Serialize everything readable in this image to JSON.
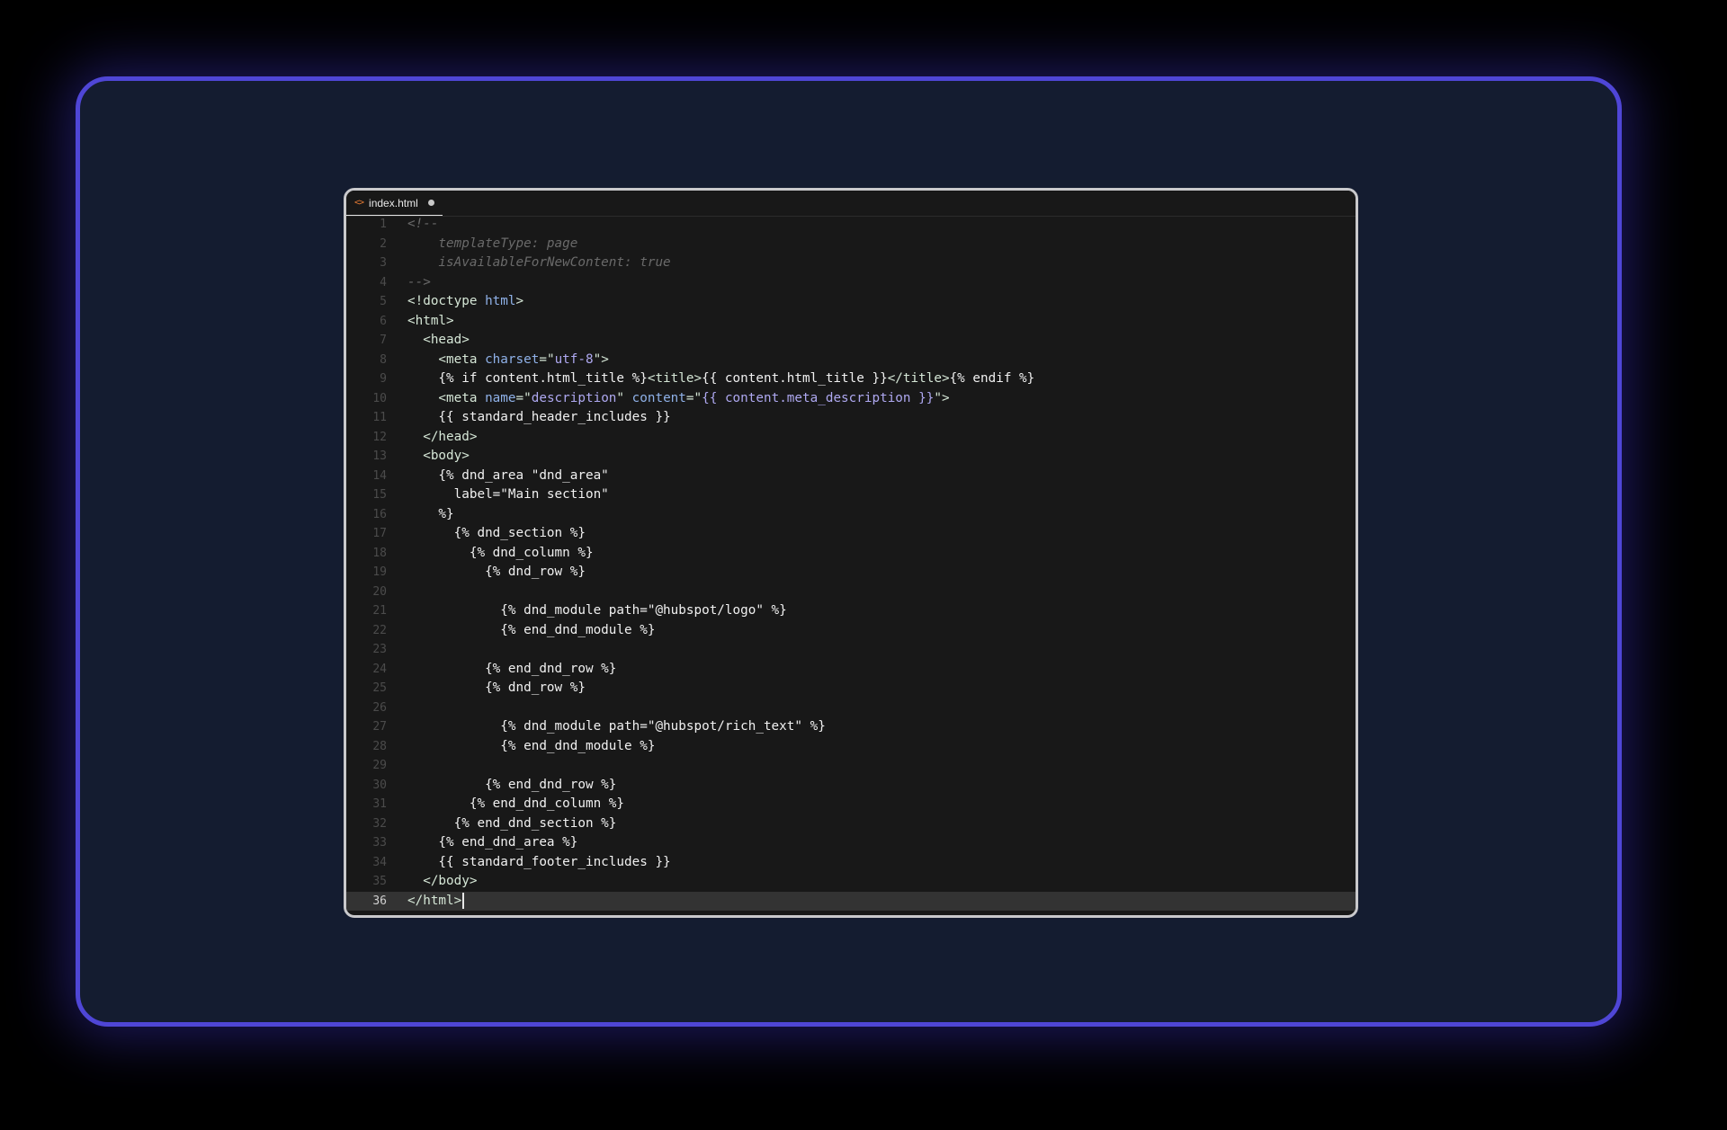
{
  "editor": {
    "tab": {
      "icon": "<>",
      "filename": "index.html",
      "unsaved_indicator": "●"
    },
    "active_line": 36,
    "lines": [
      {
        "n": "1",
        "parts": [
          {
            "t": "<!--",
            "c": "cmt"
          }
        ]
      },
      {
        "n": "2",
        "parts": [
          {
            "t": "    templateType: page",
            "c": "cmt"
          }
        ]
      },
      {
        "n": "3",
        "parts": [
          {
            "t": "    isAvailableForNewContent: true",
            "c": "cmt"
          }
        ]
      },
      {
        "n": "4",
        "parts": [
          {
            "t": "-->",
            "c": "cmt"
          }
        ]
      },
      {
        "n": "5",
        "parts": [
          {
            "t": "<!doctype ",
            "c": "tag"
          },
          {
            "t": "html",
            "c": "attr"
          },
          {
            "t": ">",
            "c": "tag"
          }
        ]
      },
      {
        "n": "6",
        "parts": [
          {
            "t": "<html>",
            "c": "tag"
          }
        ]
      },
      {
        "n": "7",
        "parts": [
          {
            "t": "  <head>",
            "c": "tag"
          }
        ]
      },
      {
        "n": "8",
        "parts": [
          {
            "t": "    <meta ",
            "c": "tag"
          },
          {
            "t": "charset",
            "c": "attr"
          },
          {
            "t": "=\"",
            "c": "tag"
          },
          {
            "t": "utf-8",
            "c": "str"
          },
          {
            "t": "\">",
            "c": "tag"
          }
        ]
      },
      {
        "n": "9",
        "parts": [
          {
            "t": "    {% if content.html_title %}",
            "c": "tpl"
          },
          {
            "t": "<title>",
            "c": "tag"
          },
          {
            "t": "{{ content.html_title }}",
            "c": "tpl"
          },
          {
            "t": "</title>",
            "c": "tag"
          },
          {
            "t": "{% endif %}",
            "c": "tpl"
          }
        ]
      },
      {
        "n": "10",
        "parts": [
          {
            "t": "    <meta ",
            "c": "tag"
          },
          {
            "t": "name",
            "c": "attr"
          },
          {
            "t": "=\"",
            "c": "tag"
          },
          {
            "t": "description",
            "c": "str"
          },
          {
            "t": "\" ",
            "c": "tag"
          },
          {
            "t": "content",
            "c": "attr"
          },
          {
            "t": "=\"",
            "c": "tag"
          },
          {
            "t": "{{ content.meta_description }}",
            "c": "str"
          },
          {
            "t": "\">",
            "c": "tag"
          }
        ]
      },
      {
        "n": "11",
        "parts": [
          {
            "t": "    {{ standard_header_includes }}",
            "c": "tpl"
          }
        ]
      },
      {
        "n": "12",
        "parts": [
          {
            "t": "  </head>",
            "c": "tag"
          }
        ]
      },
      {
        "n": "13",
        "parts": [
          {
            "t": "  <body>",
            "c": "tag"
          }
        ]
      },
      {
        "n": "14",
        "parts": [
          {
            "t": "    {% dnd_area \"dnd_area\"",
            "c": "tpl"
          }
        ]
      },
      {
        "n": "15",
        "parts": [
          {
            "t": "      label=\"Main section\"",
            "c": "tpl"
          }
        ]
      },
      {
        "n": "16",
        "parts": [
          {
            "t": "    %}",
            "c": "tpl"
          }
        ]
      },
      {
        "n": "17",
        "parts": [
          {
            "t": "      {% dnd_section %}",
            "c": "tpl"
          }
        ]
      },
      {
        "n": "18",
        "parts": [
          {
            "t": "        {% dnd_column %}",
            "c": "tpl"
          }
        ]
      },
      {
        "n": "19",
        "parts": [
          {
            "t": "          {% dnd_row %}",
            "c": "tpl"
          }
        ]
      },
      {
        "n": "20",
        "parts": [
          {
            "t": "",
            "c": "tpl"
          }
        ]
      },
      {
        "n": "21",
        "parts": [
          {
            "t": "            {% dnd_module path=\"@hubspot/logo\" %}",
            "c": "tpl"
          }
        ]
      },
      {
        "n": "22",
        "parts": [
          {
            "t": "            {% end_dnd_module %}",
            "c": "tpl"
          }
        ]
      },
      {
        "n": "23",
        "parts": [
          {
            "t": "",
            "c": "tpl"
          }
        ]
      },
      {
        "n": "24",
        "parts": [
          {
            "t": "          {% end_dnd_row %}",
            "c": "tpl"
          }
        ]
      },
      {
        "n": "25",
        "parts": [
          {
            "t": "          {% dnd_row %}",
            "c": "tpl"
          }
        ]
      },
      {
        "n": "26",
        "parts": [
          {
            "t": "",
            "c": "tpl"
          }
        ]
      },
      {
        "n": "27",
        "parts": [
          {
            "t": "            {% dnd_module path=\"@hubspot/rich_text\" %}",
            "c": "tpl"
          }
        ]
      },
      {
        "n": "28",
        "parts": [
          {
            "t": "            {% end_dnd_module %}",
            "c": "tpl"
          }
        ]
      },
      {
        "n": "29",
        "parts": [
          {
            "t": "",
            "c": "tpl"
          }
        ]
      },
      {
        "n": "30",
        "parts": [
          {
            "t": "          {% end_dnd_row %}",
            "c": "tpl"
          }
        ]
      },
      {
        "n": "31",
        "parts": [
          {
            "t": "        {% end_dnd_column %}",
            "c": "tpl"
          }
        ]
      },
      {
        "n": "32",
        "parts": [
          {
            "t": "      {% end_dnd_section %}",
            "c": "tpl"
          }
        ]
      },
      {
        "n": "33",
        "parts": [
          {
            "t": "    {% end_dnd_area %}",
            "c": "tpl"
          }
        ]
      },
      {
        "n": "34",
        "parts": [
          {
            "t": "    {{ standard_footer_includes }}",
            "c": "tpl"
          }
        ]
      },
      {
        "n": "35",
        "parts": [
          {
            "t": "  </body>",
            "c": "tag"
          }
        ]
      },
      {
        "n": "36",
        "parts": [
          {
            "t": "</html>",
            "c": "tag"
          }
        ]
      }
    ]
  }
}
